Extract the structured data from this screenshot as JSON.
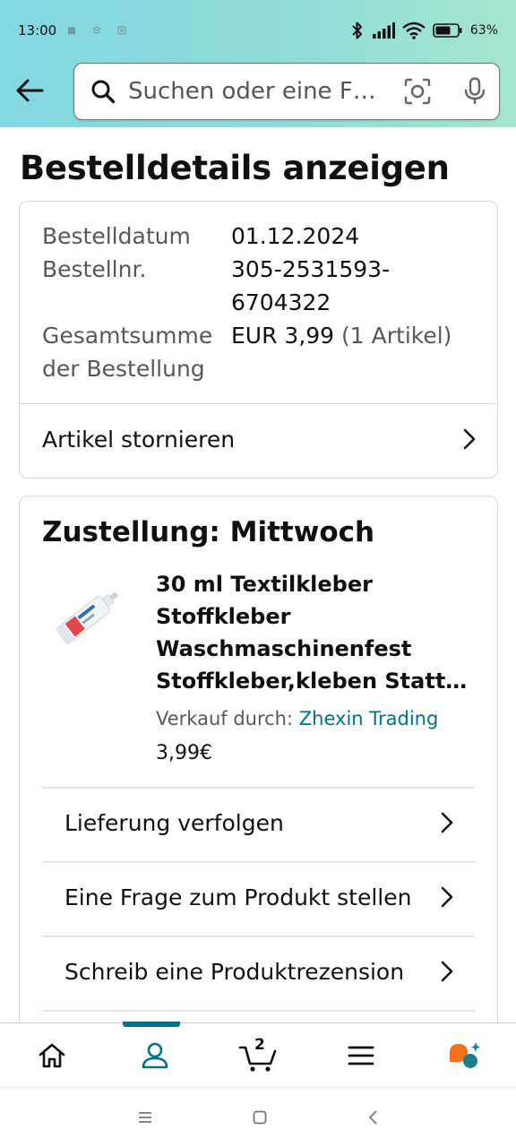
{
  "status_bar": {
    "time": "13:00",
    "battery_percent": "63%"
  },
  "search": {
    "placeholder": "Suchen oder eine F…"
  },
  "page": {
    "title": "Bestelldetails anzeigen"
  },
  "order_summary": {
    "date_label": "Bestelldatum",
    "date_value": "01.12.2024",
    "number_label": "Bestellnr.",
    "number_line1": "305-2531593-",
    "number_line2": "6704322",
    "total_label_line1": "Gesamtsumme",
    "total_label_line2": "der Bestellung",
    "total_value": "EUR 3,99",
    "total_items": "(1 Artikel)",
    "cancel_label": "Artikel stornieren"
  },
  "delivery": {
    "title": "Zustellung: Mittwoch",
    "product": {
      "title_line1": "30 ml Textilkleber",
      "title_line2": "Stoffkleber",
      "title_line3": "Waschmaschinenfest",
      "title_line4": "Stoffkleber,kleben Statt…",
      "seller_prefix": "Verkauf durch:",
      "seller_name": "Zhexin Trading",
      "price": "3,99€"
    },
    "actions": [
      {
        "label": "Lieferung verfolgen"
      },
      {
        "label": "Eine Frage zum Produkt stellen"
      },
      {
        "label": "Schreib eine Produktrezension"
      }
    ]
  },
  "bottom_nav": {
    "cart_count": "2",
    "items": [
      "home-icon",
      "account-icon",
      "cart-icon",
      "menu-icon",
      "assistant-icon"
    ]
  },
  "colors": {
    "accent": "#007185",
    "assistant_orange": "#f3701e",
    "header_gradient_start": "#82d8e3",
    "header_gradient_end": "#a5e6cf"
  }
}
